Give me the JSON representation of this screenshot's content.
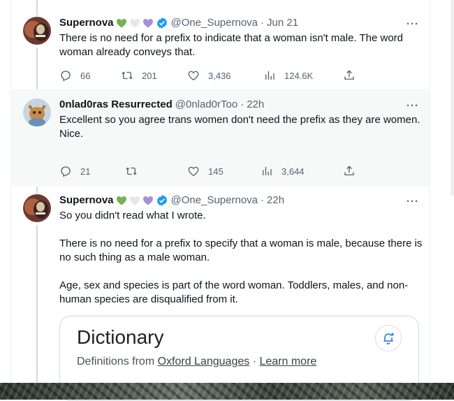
{
  "colors": {
    "verified": "#1d9bf0",
    "green_heart": "#78b159",
    "white_heart": "#e6e7e8",
    "purple_heart": "#aa8ed6",
    "muted": "#536471"
  },
  "tweets": [
    {
      "name": "Supernova",
      "hearts": [
        "green-heart",
        "white-heart",
        "purple-heart"
      ],
      "verified": true,
      "handle": "@One_Supernova",
      "sep": "·",
      "time": "Jun 21",
      "text": "There is no need for a prefix to indicate that a woman isn't male. The word woman already conveys that.",
      "replies": "66",
      "retweets": "201",
      "likes": "3,436",
      "views": "124.6K"
    },
    {
      "name": "0nlad0ras Resurrected",
      "handle": "@0nlad0rToo",
      "sep": "·",
      "time": "22h",
      "text": "Excellent so you agree trans women don't need the prefix as they are women.\nNice.",
      "replies": "21",
      "retweets": "",
      "likes": "145",
      "views": "3,644"
    },
    {
      "name": "Supernova",
      "hearts": [
        "green-heart",
        "white-heart",
        "purple-heart"
      ],
      "verified": true,
      "handle": "@One_Supernova",
      "sep": "·",
      "time": "22h",
      "text": "So you didn't read what I wrote.\n\nThere is no need for a prefix to specify that a woman is male, because there is no such thing as a male woman.\n\nAge, sex and species is part of the word woman. Toddlers, males, and non-human species are disqualified from it."
    }
  ],
  "more_label": "···",
  "card": {
    "title": "Dictionary",
    "sub_prefix": "Definitions from ",
    "source_link": "Oxford Languages",
    "dot": " · ",
    "learn_more": "Learn more"
  }
}
